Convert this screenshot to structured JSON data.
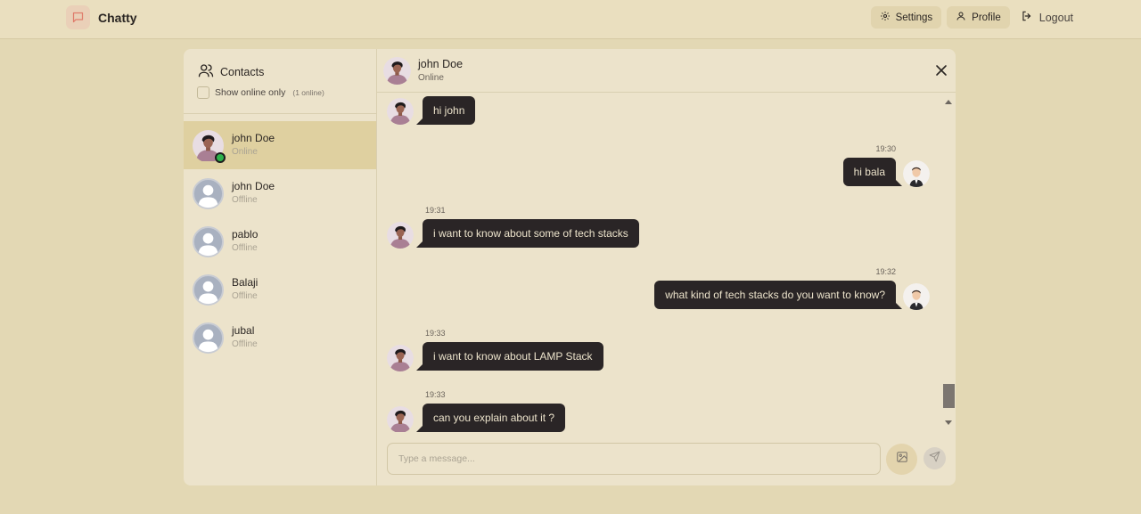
{
  "app": {
    "name": "Chatty"
  },
  "navbar": {
    "settings_label": "Settings",
    "profile_label": "Profile",
    "logout_label": "Logout"
  },
  "sidebar": {
    "title": "Contacts",
    "filter_label": "Show online only",
    "online_count": "(1 online)",
    "contacts": [
      {
        "name": "john Doe",
        "status": "Online",
        "active": true,
        "avatar": "illustrated-avatar"
      },
      {
        "name": "john Doe",
        "status": "Offline",
        "active": false,
        "avatar": "default-avatar"
      },
      {
        "name": "pablo",
        "status": "Offline",
        "active": false,
        "avatar": "default-avatar"
      },
      {
        "name": "Balaji",
        "status": "Offline",
        "active": false,
        "avatar": "default-avatar"
      },
      {
        "name": "jubal",
        "status": "Offline",
        "active": false,
        "avatar": "default-avatar"
      }
    ]
  },
  "chat": {
    "name": "john Doe",
    "status": "Online",
    "messages": [
      {
        "side": "left",
        "time": "",
        "text": "hi john"
      },
      {
        "side": "right",
        "time": "19:30",
        "text": "hi bala"
      },
      {
        "side": "left",
        "time": "19:31",
        "text": "i want to know about some of tech stacks"
      },
      {
        "side": "right",
        "time": "19:32",
        "text": "what kind of tech stacks do you want to know?"
      },
      {
        "side": "left",
        "time": "19:33",
        "text": "i want to know about LAMP Stack"
      },
      {
        "side": "left",
        "time": "19:33",
        "text": "can you explain about it ?"
      }
    ],
    "input_placeholder": "Type a message..."
  },
  "colors": {
    "background": "#e3d8b4",
    "card": "#ece3cb",
    "active_contact": "#dfd0a0",
    "bubble": "#2a2526",
    "online_dot": "#2fb24c"
  }
}
